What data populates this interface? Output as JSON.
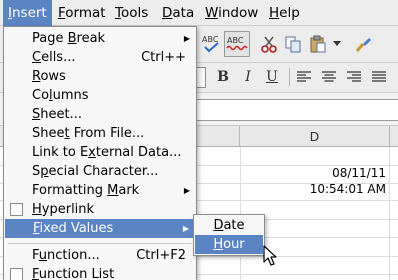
{
  "menubar": {
    "items": [
      {
        "pre": "",
        "key": "I",
        "rest": "nsert"
      },
      {
        "pre": "",
        "key": "F",
        "rest": "ormat"
      },
      {
        "pre": "",
        "key": "T",
        "rest": "ools"
      },
      {
        "pre": "",
        "key": "D",
        "rest": "ata"
      },
      {
        "pre": "",
        "key": "W",
        "rest": "indow"
      },
      {
        "pre": "",
        "key": "H",
        "rest": "elp"
      }
    ]
  },
  "toolbar": {
    "icons": [
      "spellcheck-icon",
      "autospellcheck-icon",
      "cut-icon",
      "copy-icon",
      "paste-icon",
      "dropdown-icon",
      "clone-format-icon"
    ],
    "spell_label": "ABC",
    "format": {
      "bold": "B",
      "italic": "I",
      "underline": "U"
    }
  },
  "sheet": {
    "column_d": "D",
    "cells": {
      "date": "08/11/11",
      "time": "10:54:01 AM"
    }
  },
  "insert_menu": {
    "items": [
      {
        "pre": "Page ",
        "key": "B",
        "rest": "reak",
        "shortcut": "",
        "submenu": true
      },
      {
        "pre": "",
        "key": "C",
        "rest": "ells...",
        "shortcut": "Ctrl++",
        "submenu": false
      },
      {
        "pre": "",
        "key": "R",
        "rest": "ows",
        "shortcut": "",
        "submenu": false
      },
      {
        "pre": "Co",
        "key": "l",
        "rest": "umns",
        "shortcut": "",
        "submenu": false
      },
      {
        "pre": "",
        "key": "S",
        "rest": "heet...",
        "shortcut": "",
        "submenu": false
      },
      {
        "pre": "Shee",
        "key": "t",
        "rest": " From File...",
        "shortcut": "",
        "submenu": false
      },
      {
        "pre": "Link to E",
        "key": "x",
        "rest": "ternal Data...",
        "shortcut": "",
        "submenu": false
      },
      {
        "pre": "S",
        "key": "p",
        "rest": "ecial Character...",
        "shortcut": "",
        "submenu": false
      },
      {
        "pre": "Formatting ",
        "key": "M",
        "rest": "ark",
        "shortcut": "",
        "submenu": true
      },
      {
        "pre": "",
        "key": "H",
        "rest": "yperlink",
        "shortcut": "",
        "submenu": false,
        "checkbox": true
      },
      {
        "pre": "",
        "key": "F",
        "rest": "ixed Values",
        "shortcut": "",
        "submenu": true,
        "highlight": true
      },
      {
        "pre": "F",
        "key": "u",
        "rest": "nction...",
        "shortcut": "Ctrl+F2",
        "submenu": false
      },
      {
        "pre": "",
        "key": "F",
        "rest": "unction List",
        "shortcut": "",
        "submenu": false,
        "checkbox": true
      }
    ]
  },
  "fixed_values_submenu": {
    "items": [
      {
        "pre": "",
        "key": "D",
        "rest": "ate",
        "highlight": false
      },
      {
        "pre": "",
        "key": "H",
        "rest": "our",
        "highlight": true
      }
    ]
  },
  "colors": {
    "highlight": "#5b84c4",
    "menu_bg": "#f7f7f7",
    "toolbar_bg": "#ececec"
  }
}
